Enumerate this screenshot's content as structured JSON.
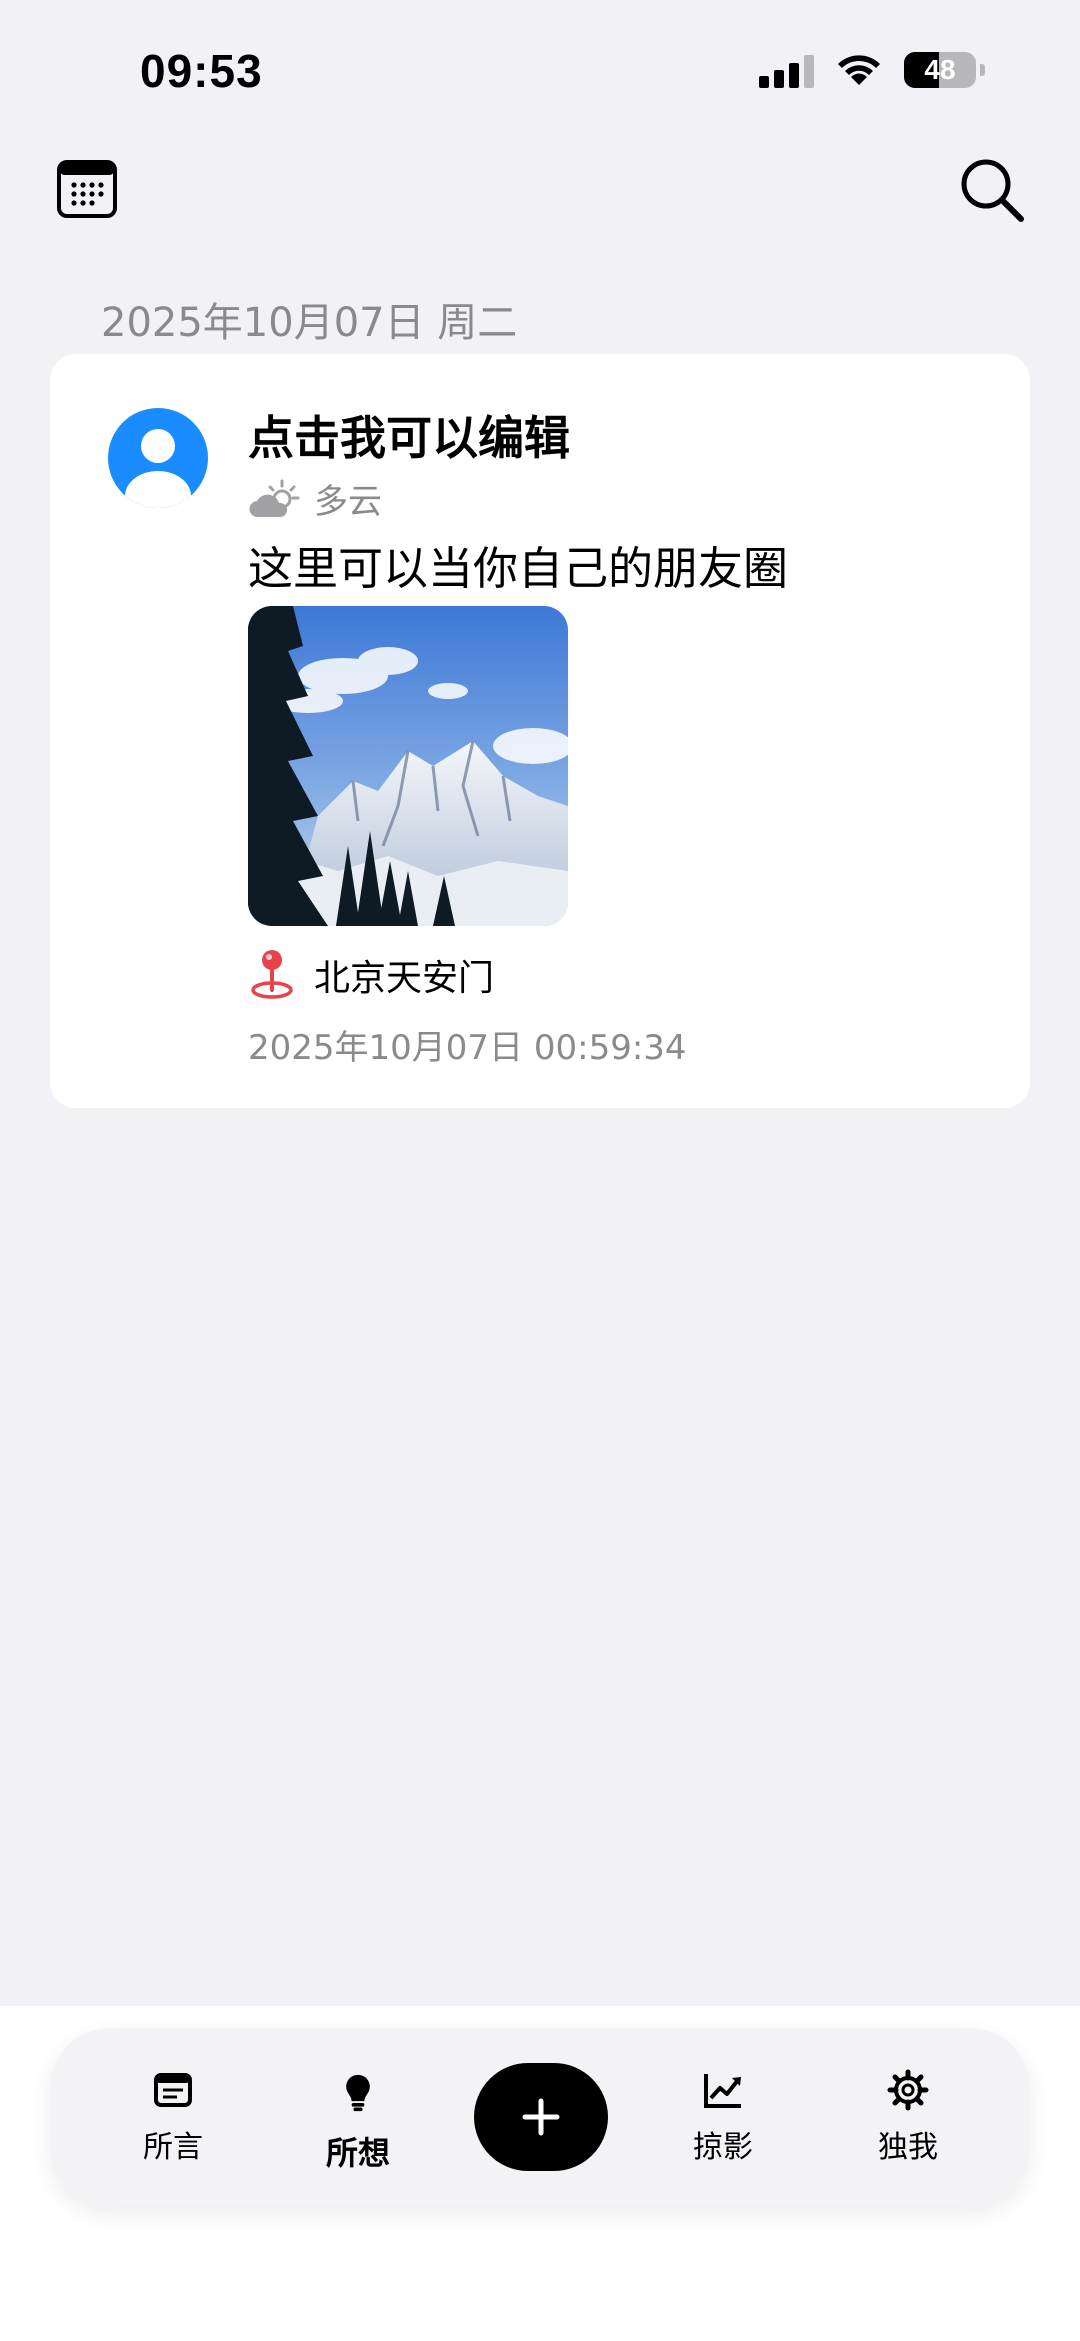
{
  "status_bar": {
    "time": "09:53",
    "battery": "48",
    "battery_level": 0.48,
    "icons": [
      "signal-icon",
      "wifi-icon",
      "battery-icon"
    ]
  },
  "toolbar": {
    "icons": [
      "calendar-icon",
      "search-icon"
    ]
  },
  "date_header": "2025年10月07日 周二",
  "post": {
    "title": "点击我可以编辑",
    "weather": "多云",
    "text": "这里可以当你自己的朋友圈",
    "location": "北京天安门",
    "timestamp": "2025年10月07日 00:59:34",
    "icons": [
      "avatar-icon",
      "cloudy-icon",
      "location-pin-icon"
    ]
  },
  "tabbar": {
    "tabs": [
      {
        "label": "所言",
        "icon": "document-icon"
      },
      {
        "label": "所想",
        "icon": "lightbulb-icon"
      },
      {
        "label": "掠影",
        "icon": "chart-icon"
      },
      {
        "label": "独我",
        "icon": "gear-icon"
      }
    ],
    "add_icon": "plus-icon"
  },
  "colors": {
    "background": "#F1F1F6",
    "accent_blue": "#1A8CFF",
    "pin_red": "#E8424A",
    "secondary_text": "#8A8A8E"
  }
}
